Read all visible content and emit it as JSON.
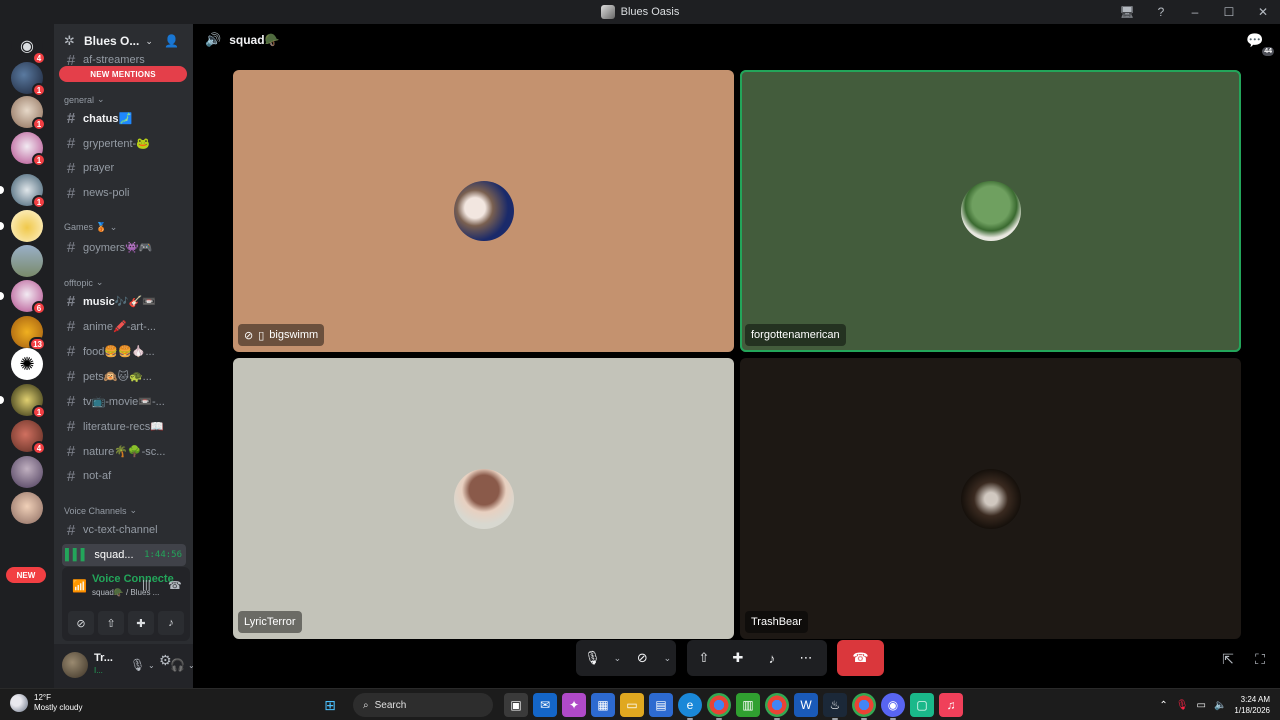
{
  "window": {
    "title": "Blues Oasis"
  },
  "colors": {
    "accent_green": "#23a55a",
    "danger_red": "#da373c",
    "sidebar_bg": "#2b2d31",
    "rail_bg": "#1e1f22"
  },
  "servers": [
    {
      "icon": "discord-home-icon",
      "badge": "4"
    },
    {
      "badge": "1"
    },
    {
      "badge": "1"
    },
    {
      "badge": "1"
    },
    {
      "badge": "1"
    },
    {
      "badge": ""
    },
    {
      "badge": ""
    },
    {
      "badge": "6"
    },
    {
      "badge": "13"
    },
    {
      "badge": ""
    },
    {
      "badge": "1"
    },
    {
      "badge": "4"
    },
    {
      "badge": ""
    },
    {
      "badge": ""
    }
  ],
  "servers_new_label": "NEW",
  "sidebar": {
    "server_name": "Blues O...",
    "new_mentions": "NEW MENTIONS",
    "top_partial_channel": "af-streamers",
    "categories": [
      {
        "name": "general"
      },
      {
        "name": "Games 🥉"
      },
      {
        "name": "offtopic"
      },
      {
        "name": "Voice Channels"
      }
    ],
    "channels": [
      {
        "name": "chatus🗾"
      },
      {
        "name": "grypertent-🐸"
      },
      {
        "name": "prayer"
      },
      {
        "name": "news-poli"
      },
      {
        "name": "goymers👾🎮"
      },
      {
        "name": "music🎶🎸📼"
      },
      {
        "name": "anime🖍️-art-..."
      },
      {
        "name": "food🍔🍔🧄..."
      },
      {
        "name": "pets🙉🐱🐢..."
      },
      {
        "name": "tv📺-movie📼-..."
      },
      {
        "name": "literature-recs📖"
      },
      {
        "name": "nature🌴🌳-sc..."
      },
      {
        "name": "not-af"
      },
      {
        "name": "vc-text-channel"
      }
    ],
    "voice_channel": {
      "name": "squad...",
      "timer": "1:44:56"
    }
  },
  "voice_panel": {
    "title": "Voice Connecte",
    "subtitle": "squad🪖 / Blues ..."
  },
  "user": {
    "name": "Tr...",
    "status": "I..."
  },
  "main": {
    "channel_name": "squad🪖",
    "chat_count": "44",
    "tiles": [
      {
        "name": "bigswimm",
        "bg": "#c4926f",
        "speaking": false,
        "muted": true
      },
      {
        "name": "forgottenamerican",
        "bg": "#435c3c",
        "speaking": true,
        "muted": false
      },
      {
        "name": "LyricTerror",
        "bg": "#c3c3b9",
        "speaking": false,
        "muted": false
      },
      {
        "name": "TrashBear",
        "bg": "#1d1814",
        "speaking": false,
        "muted": false
      }
    ]
  },
  "taskbar": {
    "weather_temp": "12°F",
    "weather_desc": "Mostly cloudy",
    "search_label": "Search",
    "time": "3:24 AM",
    "date": "1/18/2026"
  }
}
